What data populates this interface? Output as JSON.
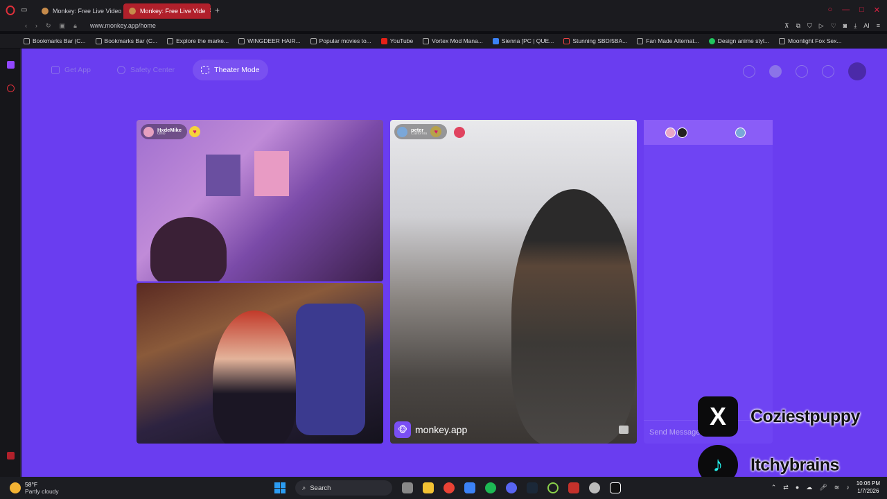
{
  "browser": {
    "tabs": [
      {
        "label": "Monkey: Free Live Video C",
        "active": false
      },
      {
        "label": "Monkey: Free Live Vide",
        "active": true
      }
    ],
    "url": "www.monkey.app/home",
    "ai_label": "AI",
    "bookmarks": [
      "Bookmarks Bar (C...",
      "Bookmarks Bar (C...",
      "Explore the marke...",
      "WINGDEER HAIR...",
      "Popular movies to...",
      "YouTube",
      "Vortex Mod Mana...",
      "Sienna [PC | QUE...",
      "Stunning SBD/5BA...",
      "Fan Made Alternat...",
      "Design anime styl...",
      "Moonlight Fox Sex..."
    ]
  },
  "app": {
    "buttons": {
      "get_app": "Get App",
      "safety_center": "Safety Center",
      "theater_mode": "Theater Mode"
    },
    "accent_color": "#6a3df0"
  },
  "videos": {
    "top_left": {
      "name": "HxdeMike",
      "location": "Ohio"
    },
    "right": {
      "name": "peter",
      "location": "California"
    },
    "watermark": "monkey.app"
  },
  "chat": {
    "input_placeholder": "Send Message"
  },
  "overlay": {
    "x_handle": "Coziestpuppy",
    "tiktok_handle": "Itchybrains"
  },
  "taskbar": {
    "temperature": "58°F",
    "condition": "Partly cloudy",
    "search_label": "Search",
    "time": "10:06 PM",
    "date": "1/7/2026"
  }
}
